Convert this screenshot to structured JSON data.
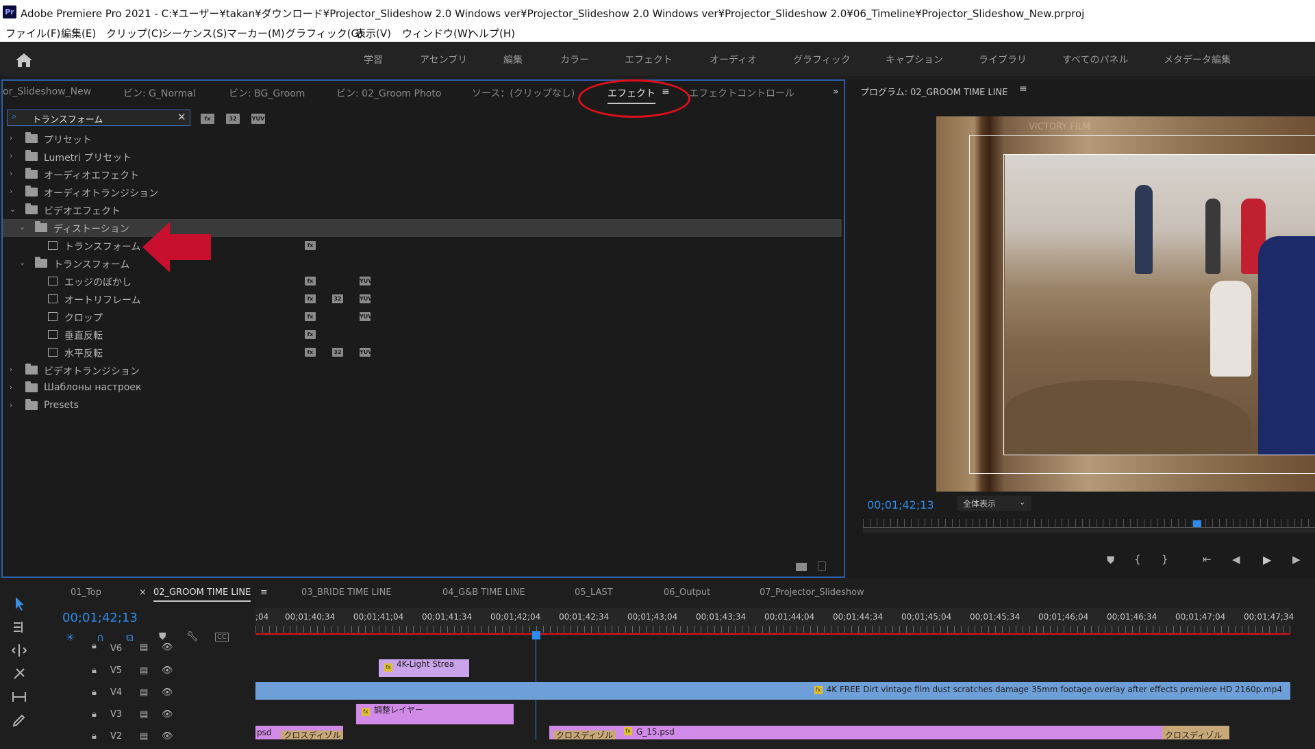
{
  "title_bar": {
    "app_badge": "Pr",
    "title": "Adobe Premiere Pro 2021 - C:¥ユーザー¥takan¥ダウンロード¥Projector_Slideshow 2.0 Windows ver¥Projector_Slideshow 2.0 Windows ver¥Projector_Slideshow 2.0¥06_Timeline¥Projector_Slideshow_New.prproj"
  },
  "menu": [
    "ファイル(F)",
    "編集(E)",
    "クリップ(C)",
    "シーケンス(S)",
    "マーカー(M)",
    "グラフィック(G)",
    "表示(V)",
    "ウィンドウ(W)",
    "ヘルプ(H)"
  ],
  "workspaces": [
    "学習",
    "アセンブリ",
    "編集",
    "カラー",
    "エフェクト",
    "オーディオ",
    "グラフィック",
    "キャプション",
    "ライブラリ",
    "すべてのパネル",
    "メタデータ編集"
  ],
  "effects_panel": {
    "tabs": [
      "or_Slideshow_New",
      "ビン: G_Normal",
      "ビン: BG_Groom",
      "ビン: 02_Groom Photo",
      "ソース：(クリップなし)",
      "エフェクト",
      "エフェクトコントロール"
    ],
    "active_tab": "エフェクト",
    "search_value": "トランスフォーム",
    "tree": [
      {
        "label": "プリセット",
        "level": 0,
        "kind": "folder",
        "expanded": false
      },
      {
        "label": "Lumetri プリセット",
        "level": 0,
        "kind": "folder",
        "expanded": false
      },
      {
        "label": "オーディオエフェクト",
        "level": 0,
        "kind": "folder",
        "expanded": false
      },
      {
        "label": "オーディオトランジション",
        "level": 0,
        "kind": "folder",
        "expanded": false
      },
      {
        "label": "ビデオエフェクト",
        "level": 0,
        "kind": "folder",
        "expanded": true
      },
      {
        "label": "ディストーション",
        "level": 1,
        "kind": "folder",
        "expanded": true,
        "selected": true
      },
      {
        "label": "トランスフォーム",
        "level": 2,
        "kind": "effect",
        "badges": [
          1
        ]
      },
      {
        "label": "トランスフォーム",
        "level": 1,
        "kind": "folder",
        "expanded": true
      },
      {
        "label": "エッジのぼかし",
        "level": 2,
        "kind": "effect",
        "badges": [
          1,
          3
        ]
      },
      {
        "label": "オートリフレーム",
        "level": 2,
        "kind": "effect",
        "badges": [
          1,
          2,
          3
        ]
      },
      {
        "label": "クロップ",
        "level": 2,
        "kind": "effect",
        "badges": [
          1,
          3
        ]
      },
      {
        "label": "垂直反転",
        "level": 2,
        "kind": "effect",
        "badges": [
          1
        ]
      },
      {
        "label": "水平反転",
        "level": 2,
        "kind": "effect",
        "badges": [
          1,
          2,
          3
        ]
      },
      {
        "label": "ビデオトランジション",
        "level": 0,
        "kind": "folder",
        "expanded": false
      },
      {
        "label": "Шаблоны настроек",
        "level": 0,
        "kind": "folder",
        "expanded": false
      },
      {
        "label": "Presets",
        "level": 0,
        "kind": "folder",
        "expanded": false
      }
    ]
  },
  "program_monitor": {
    "title": "プログラム: 02_GROOM TIME LINE",
    "timecode": "00;01;42;13",
    "zoom": "全体表示",
    "overlay_text": "VICTORY FILM",
    "playhead_fraction": 0.74
  },
  "timeline": {
    "tabs": [
      "01_Top",
      "02_GROOM TIME LINE",
      "03_BRIDE TIME LINE",
      "04_G&B TIME LINE",
      "05_LAST",
      "06_Output",
      "07_Projector_Slideshow"
    ],
    "active_tab": "02_GROOM TIME LINE",
    "timecode": "00;01;42;13",
    "ruler": [
      ";04",
      "00;01;40;34",
      "00;01;41;04",
      "00;01;41;34",
      "00;01;42;04",
      "00;01;42;34",
      "00;01;43;04",
      "00;01;43;34",
      "00;01;44;04",
      "00;01;44;34",
      "00;01;45;04",
      "00;01;45;34",
      "00;01;46;04",
      "00;01;46;34",
      "00;01;47;04",
      "00;01;47;34"
    ],
    "tracks": [
      "V6",
      "V5",
      "V4",
      "V3",
      "V2"
    ],
    "clips": {
      "v5": "4K-Light Strea",
      "v4": "4K FREE Dirt vintage film dust scratches damage 35mm footage overlay after effects premiere HD 2160p.mp4",
      "v3": "調整レイヤー",
      "v2a": "psd",
      "v2b": "クロスディゾル",
      "v2c": "クロスディゾル",
      "v2d": "G_15.psd",
      "v2e": "クロスディゾル"
    }
  },
  "badge_text": {
    "b1": "fx",
    "b2": "32",
    "b3": "YUV"
  },
  "colors": {
    "accent_blue": "#2d8ceb",
    "highlight_red": "#e0101a",
    "arrow_red": "#c8102e",
    "clip_purple": "#d28ae8",
    "clip_blue": "#6f9fd8",
    "clip_lavender": "#c9a4ea"
  }
}
